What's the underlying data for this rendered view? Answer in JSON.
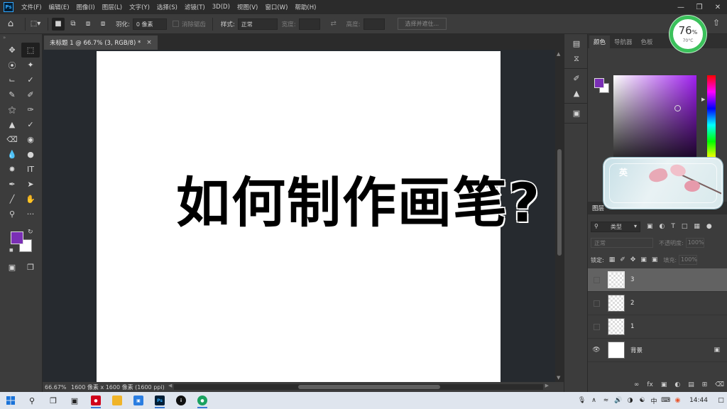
{
  "app": {
    "logo": "Ps",
    "menu": [
      "文件(F)",
      "编辑(E)",
      "图像(I)",
      "图层(L)",
      "文字(Y)",
      "选择(S)",
      "滤镜(T)",
      "3D(D)",
      "视图(V)",
      "窗口(W)",
      "帮助(H)"
    ]
  },
  "options": {
    "feather_label": "羽化:",
    "feather_value": "0 像素",
    "antialias_label": "消除锯齿",
    "style_label": "样式:",
    "style_value": "正常",
    "width_label": "宽度:",
    "height_label": "高度:",
    "select_mask_button": "选择并遮住..."
  },
  "document": {
    "tab_title": "未标题 1 @ 66.7% (3, RGB/8) *",
    "overlay_text": "如何制作画笔?",
    "status_zoom": "66.67%",
    "status_info": "1600 像素 x 1600 像素 (1600 ppi)"
  },
  "color_panel": {
    "tabs": [
      "颜色",
      "导航器",
      "色板"
    ],
    "foreground": "#7a2fb5",
    "background": "#ffffff"
  },
  "layers_panel": {
    "title": "图层",
    "filter_kind": "类型",
    "blend_mode": "正常",
    "opacity_label": "不透明度:",
    "opacity_value": "100%",
    "lock_label": "锁定:",
    "fill_label": "填充:",
    "fill_value": "100%",
    "layers": [
      {
        "name": "3"
      },
      {
        "name": "2"
      },
      {
        "name": "1"
      },
      {
        "name": "背景"
      }
    ]
  },
  "widgets": {
    "cpu_percent": "76",
    "cpu_percent_suffix": "%",
    "cpu_temp": "70°C",
    "ime_char": "英"
  },
  "taskbar": {
    "time": "14:44",
    "ime_lang": "中"
  }
}
